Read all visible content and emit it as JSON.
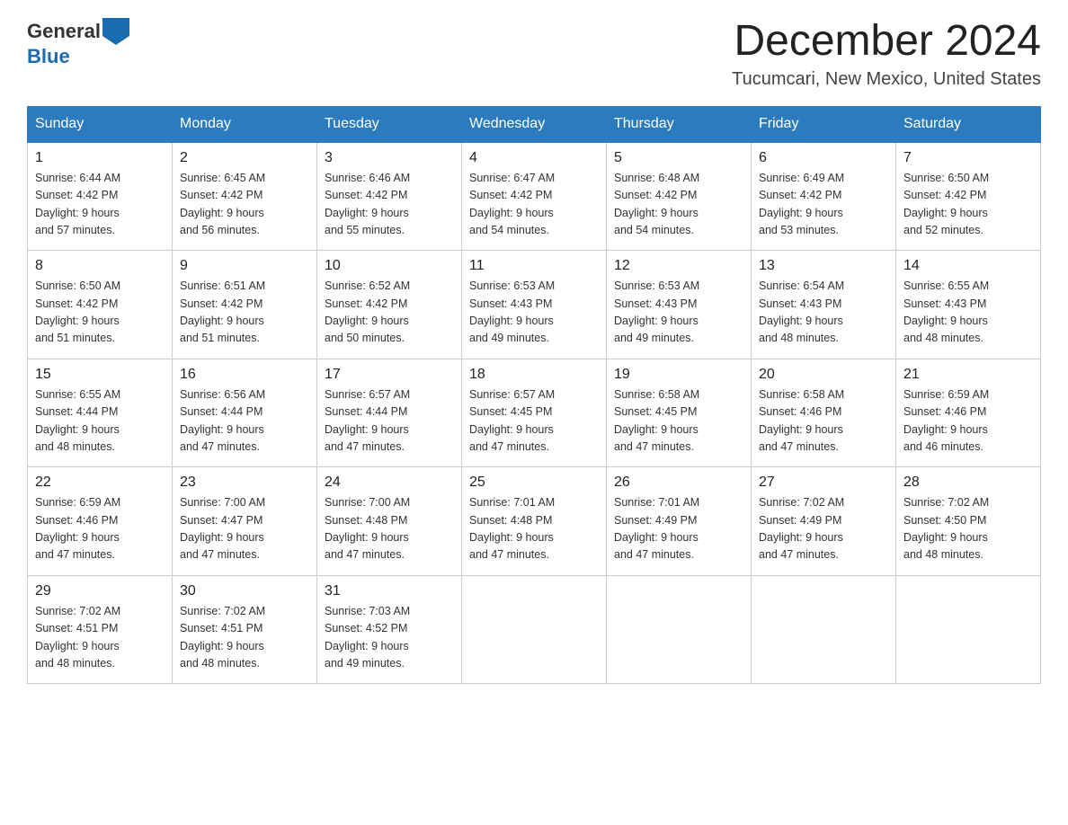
{
  "header": {
    "logo_general": "General",
    "logo_blue": "Blue",
    "title": "December 2024",
    "subtitle": "Tucumcari, New Mexico, United States"
  },
  "weekdays": [
    "Sunday",
    "Monday",
    "Tuesday",
    "Wednesday",
    "Thursday",
    "Friday",
    "Saturday"
  ],
  "weeks": [
    [
      {
        "day": "1",
        "sunrise": "6:44 AM",
        "sunset": "4:42 PM",
        "daylight": "9 hours and 57 minutes."
      },
      {
        "day": "2",
        "sunrise": "6:45 AM",
        "sunset": "4:42 PM",
        "daylight": "9 hours and 56 minutes."
      },
      {
        "day": "3",
        "sunrise": "6:46 AM",
        "sunset": "4:42 PM",
        "daylight": "9 hours and 55 minutes."
      },
      {
        "day": "4",
        "sunrise": "6:47 AM",
        "sunset": "4:42 PM",
        "daylight": "9 hours and 54 minutes."
      },
      {
        "day": "5",
        "sunrise": "6:48 AM",
        "sunset": "4:42 PM",
        "daylight": "9 hours and 54 minutes."
      },
      {
        "day": "6",
        "sunrise": "6:49 AM",
        "sunset": "4:42 PM",
        "daylight": "9 hours and 53 minutes."
      },
      {
        "day": "7",
        "sunrise": "6:50 AM",
        "sunset": "4:42 PM",
        "daylight": "9 hours and 52 minutes."
      }
    ],
    [
      {
        "day": "8",
        "sunrise": "6:50 AM",
        "sunset": "4:42 PM",
        "daylight": "9 hours and 51 minutes."
      },
      {
        "day": "9",
        "sunrise": "6:51 AM",
        "sunset": "4:42 PM",
        "daylight": "9 hours and 51 minutes."
      },
      {
        "day": "10",
        "sunrise": "6:52 AM",
        "sunset": "4:42 PM",
        "daylight": "9 hours and 50 minutes."
      },
      {
        "day": "11",
        "sunrise": "6:53 AM",
        "sunset": "4:43 PM",
        "daylight": "9 hours and 49 minutes."
      },
      {
        "day": "12",
        "sunrise": "6:53 AM",
        "sunset": "4:43 PM",
        "daylight": "9 hours and 49 minutes."
      },
      {
        "day": "13",
        "sunrise": "6:54 AM",
        "sunset": "4:43 PM",
        "daylight": "9 hours and 48 minutes."
      },
      {
        "day": "14",
        "sunrise": "6:55 AM",
        "sunset": "4:43 PM",
        "daylight": "9 hours and 48 minutes."
      }
    ],
    [
      {
        "day": "15",
        "sunrise": "6:55 AM",
        "sunset": "4:44 PM",
        "daylight": "9 hours and 48 minutes."
      },
      {
        "day": "16",
        "sunrise": "6:56 AM",
        "sunset": "4:44 PM",
        "daylight": "9 hours and 47 minutes."
      },
      {
        "day": "17",
        "sunrise": "6:57 AM",
        "sunset": "4:44 PM",
        "daylight": "9 hours and 47 minutes."
      },
      {
        "day": "18",
        "sunrise": "6:57 AM",
        "sunset": "4:45 PM",
        "daylight": "9 hours and 47 minutes."
      },
      {
        "day": "19",
        "sunrise": "6:58 AM",
        "sunset": "4:45 PM",
        "daylight": "9 hours and 47 minutes."
      },
      {
        "day": "20",
        "sunrise": "6:58 AM",
        "sunset": "4:46 PM",
        "daylight": "9 hours and 47 minutes."
      },
      {
        "day": "21",
        "sunrise": "6:59 AM",
        "sunset": "4:46 PM",
        "daylight": "9 hours and 46 minutes."
      }
    ],
    [
      {
        "day": "22",
        "sunrise": "6:59 AM",
        "sunset": "4:46 PM",
        "daylight": "9 hours and 47 minutes."
      },
      {
        "day": "23",
        "sunrise": "7:00 AM",
        "sunset": "4:47 PM",
        "daylight": "9 hours and 47 minutes."
      },
      {
        "day": "24",
        "sunrise": "7:00 AM",
        "sunset": "4:48 PM",
        "daylight": "9 hours and 47 minutes."
      },
      {
        "day": "25",
        "sunrise": "7:01 AM",
        "sunset": "4:48 PM",
        "daylight": "9 hours and 47 minutes."
      },
      {
        "day": "26",
        "sunrise": "7:01 AM",
        "sunset": "4:49 PM",
        "daylight": "9 hours and 47 minutes."
      },
      {
        "day": "27",
        "sunrise": "7:02 AM",
        "sunset": "4:49 PM",
        "daylight": "9 hours and 47 minutes."
      },
      {
        "day": "28",
        "sunrise": "7:02 AM",
        "sunset": "4:50 PM",
        "daylight": "9 hours and 48 minutes."
      }
    ],
    [
      {
        "day": "29",
        "sunrise": "7:02 AM",
        "sunset": "4:51 PM",
        "daylight": "9 hours and 48 minutes."
      },
      {
        "day": "30",
        "sunrise": "7:02 AM",
        "sunset": "4:51 PM",
        "daylight": "9 hours and 48 minutes."
      },
      {
        "day": "31",
        "sunrise": "7:03 AM",
        "sunset": "4:52 PM",
        "daylight": "9 hours and 49 minutes."
      },
      null,
      null,
      null,
      null
    ]
  ],
  "labels": {
    "sunrise_prefix": "Sunrise: ",
    "sunset_prefix": "Sunset: ",
    "daylight_prefix": "Daylight: "
  }
}
